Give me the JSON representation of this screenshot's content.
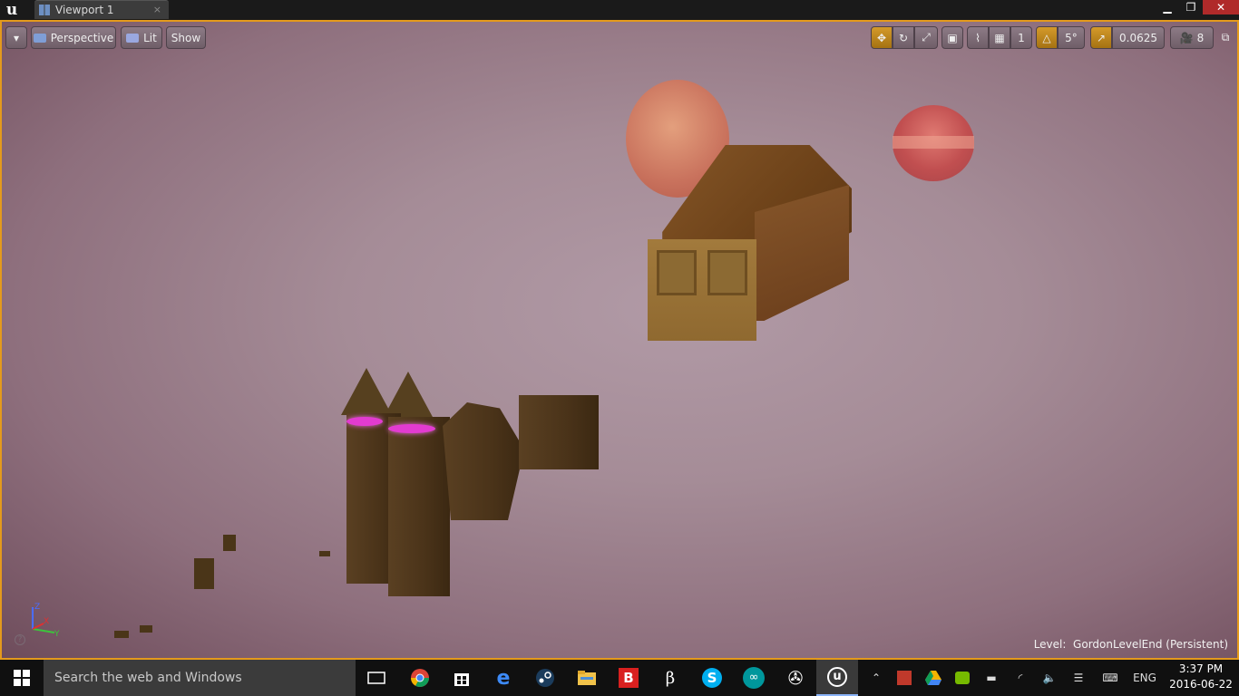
{
  "window": {
    "tab_label": "Viewport 1",
    "tab_close": "×",
    "controls": {
      "minimize": "▁",
      "maximize": "❐",
      "close": "✕"
    }
  },
  "viewport_toolbar": {
    "dropdown": "▾",
    "perspective": "Perspective",
    "lit": "Lit",
    "show": "Show",
    "rotation_snap": "5°",
    "scale_snap": "0.0625",
    "camera_speed": "8",
    "grid_snap": "1"
  },
  "viewport": {
    "level_prefix": "Level:",
    "level_name": "GordonLevelEnd (Persistent)",
    "axes": {
      "z": "Z",
      "x": "X",
      "y": "Y"
    },
    "help": "?"
  },
  "taskbar": {
    "search_placeholder": "Search the web and Windows",
    "apps": [
      "task-view",
      "chrome",
      "store",
      "edge",
      "steam",
      "file-explorer",
      "bitdefender",
      "blender-like",
      "skype",
      "arduino",
      "obs",
      "unreal-engine"
    ],
    "language": "ENG",
    "time": "3:37 PM",
    "date": "2016-06-22"
  },
  "colors": {
    "accent": "#e49a1c",
    "taskbar": "#101010",
    "search": "#3b3b3b"
  }
}
